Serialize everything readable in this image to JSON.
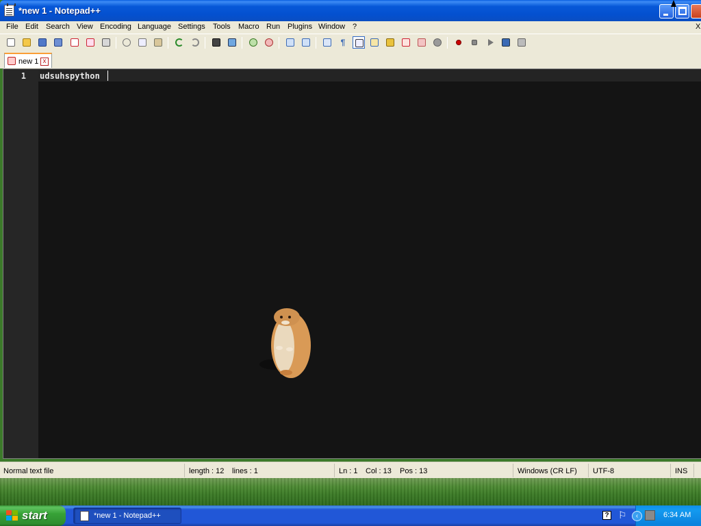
{
  "window": {
    "title": "*new 1 - Notepad++"
  },
  "menu": {
    "items": [
      "File",
      "Edit",
      "Search",
      "View",
      "Encoding",
      "Language",
      "Settings",
      "Tools",
      "Macro",
      "Run",
      "Plugins",
      "Window",
      "?"
    ],
    "mdi_close": "X"
  },
  "toolbar": {
    "icons": [
      "new-file-icon",
      "open-file-icon",
      "save-icon",
      "save-all-icon",
      "close-icon",
      "close-all-icon",
      "print-icon",
      "cut-icon",
      "copy-icon",
      "paste-icon",
      "undo-icon",
      "redo-icon",
      "find-icon",
      "replace-icon",
      "zoom-in-icon",
      "zoom-out-icon",
      "sync-vertical-icon",
      "sync-horizontal-icon",
      "word-wrap-icon",
      "show-all-chars-icon",
      "indent-guide-icon",
      "doc-map-icon",
      "function-list-icon",
      "folder-workspace-icon",
      "monitoring-icon",
      "record-macro-icon",
      "stop-macro-icon",
      "play-macro-icon",
      "run-macro-multiple-icon",
      "save-macro-icon"
    ]
  },
  "tabs": [
    {
      "label": "new 1",
      "close": "x",
      "active": true
    }
  ],
  "editor": {
    "line_number": "1",
    "line_text": "udsuhspython",
    "theme_background": "#141414"
  },
  "statusbar": {
    "file_type": "Normal text file",
    "length": "length : 12",
    "lines": "lines : 1",
    "ln": "Ln : 1",
    "col": "Col : 13",
    "pos": "Pos : 13",
    "eol": "Windows (CR LF)",
    "encoding": "UTF-8",
    "mode": "INS"
  },
  "taskbar": {
    "start_label": "start",
    "task_label": "*new 1 - Notepad++",
    "clock": "6:34 AM",
    "help": "?"
  }
}
